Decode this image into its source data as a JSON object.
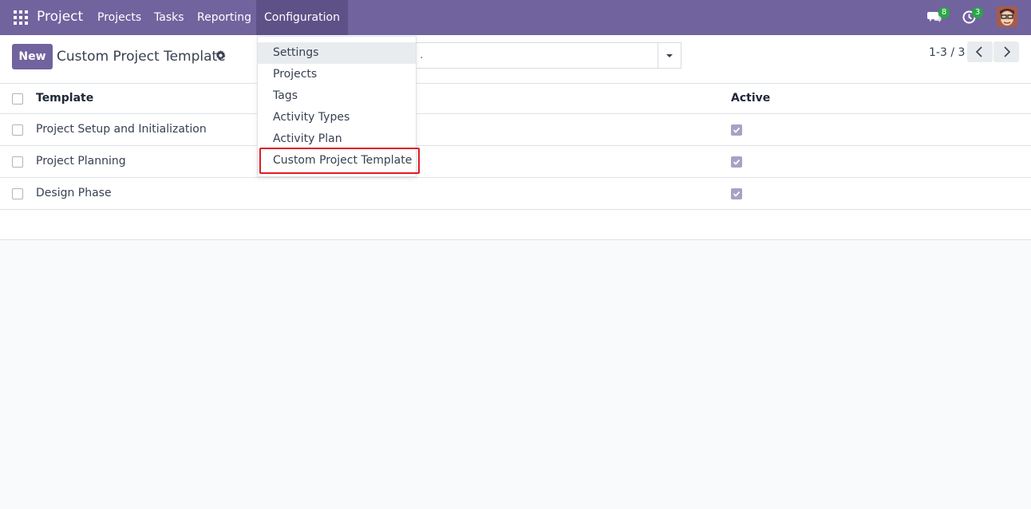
{
  "navbar": {
    "brand": "Project",
    "menus": [
      "Projects",
      "Tasks",
      "Reporting",
      "Configuration"
    ],
    "active_menu": "Configuration",
    "messages_count": "8",
    "activities_count": "3",
    "accent": "#71639e"
  },
  "control_panel": {
    "new_label": "New",
    "title": "Custom Project Template",
    "search_text": ".",
    "pager": "1-3 / 3"
  },
  "list": {
    "columns": [
      "Template",
      "Active"
    ],
    "rows": [
      {
        "name": "Project Setup and Initialization",
        "active": true
      },
      {
        "name": "Project Planning",
        "active": true
      },
      {
        "name": "Design Phase",
        "active": true
      }
    ]
  },
  "dropdown": {
    "items": [
      "Settings",
      "Projects",
      "Tags",
      "Activity Types",
      "Activity Plan",
      "Custom Project Template"
    ],
    "hovered": "Settings",
    "highlighted": "Custom Project Template",
    "highlight_color": "#e01b24"
  }
}
